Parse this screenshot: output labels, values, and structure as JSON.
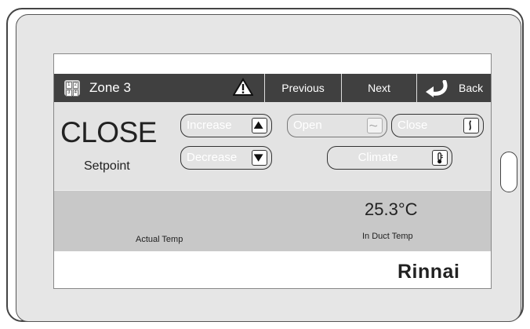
{
  "header": {
    "zone_icon_digits": [
      "1",
      "2",
      "3",
      "4"
    ],
    "zone_title": "Zone 3",
    "previous_label": "Previous",
    "next_label": "Next",
    "back_label": "Back"
  },
  "controls": {
    "status": "CLOSE",
    "setpoint_label": "Setpoint",
    "increase_label": "Increase",
    "decrease_label": "Decrease",
    "open_label": "Open",
    "close_label": "Close",
    "climate_label": "Climate"
  },
  "readings": {
    "actual_temp_label": "Actual Temp",
    "in_duct_temp_value": "25.3°C",
    "in_duct_temp_label": "In Duct Temp"
  },
  "brand": "Rinnai",
  "colors": {
    "header_bg": "#404040",
    "controls_bg": "#e3e3e3",
    "readings_bg": "#c8c8c8"
  },
  "icons": {
    "zone": "zone-grid-icon",
    "warning": "warning-triangle-icon",
    "back": "back-arrow-icon",
    "increase": "up-triangle-icon",
    "decrease": "down-triangle-icon",
    "open": "damper-open-icon",
    "close": "damper-close-icon",
    "climate": "thermometer-icon"
  }
}
